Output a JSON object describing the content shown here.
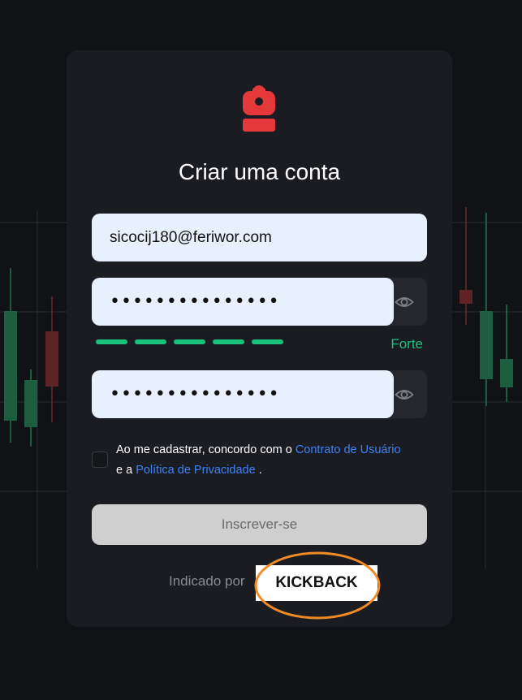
{
  "title": "Criar uma conta",
  "email": {
    "value": "sicocij180@feriwor.com",
    "placeholder": ""
  },
  "password": {
    "masked": "•••••••••••••••"
  },
  "confirm_password": {
    "masked": "•••••••••••••••"
  },
  "strength": {
    "label": "Forte",
    "segments": 5,
    "filled": 5,
    "color": "#19c37d"
  },
  "terms": {
    "prefix": "Ao me cadastrar, concordo com o ",
    "link1": "Contrato de Usuário",
    "middle": " e a ",
    "link2": "Política de Privacidade",
    "suffix": " ."
  },
  "submit_label": "Inscrever-se",
  "referral": {
    "label": "Indicado por",
    "code": "KICKBACK"
  },
  "colors": {
    "accent": "#3b82f6",
    "logo": "#e5383b",
    "highlight": "#f08a24",
    "background": "#111216",
    "card": "#1b1c21"
  },
  "icons": {
    "logo": "backpack-icon",
    "toggle": "eye-icon"
  }
}
